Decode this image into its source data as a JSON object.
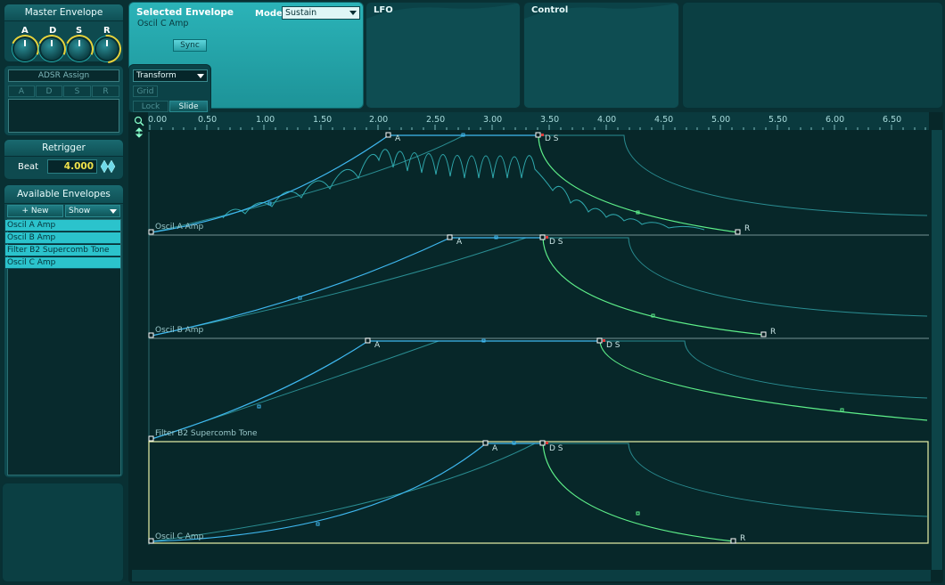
{
  "master_envelope": {
    "title": "Master Envelope",
    "knobs": [
      {
        "label": "A"
      },
      {
        "label": "D"
      },
      {
        "label": "S"
      },
      {
        "label": "R"
      }
    ]
  },
  "adsr_assign": {
    "title": "ADSR Assign",
    "slots": [
      "A",
      "D",
      "S",
      "R"
    ]
  },
  "retrigger": {
    "title": "Retrigger",
    "beat_label": "Beat",
    "beat_value": "4.000"
  },
  "available_envelopes": {
    "title": "Available Envelopes",
    "new_label": "+ New",
    "show_label": "Show",
    "items": [
      "Oscil A Amp",
      "Oscil B Amp",
      "Filter B2 Supercomb Tone",
      "Oscil C Amp"
    ]
  },
  "selected_envelope": {
    "title": "Selected Envelope",
    "name": "Oscil C Amp",
    "mode_label": "Mode",
    "mode_value": "Sustain",
    "sync_label": "Sync"
  },
  "tabs": {
    "lfo": "LFO",
    "control": "Control"
  },
  "transform": {
    "dropdown": "Transform",
    "grid": "Grid",
    "lock": "Lock",
    "slide": "Slide"
  },
  "ruler": {
    "ticks": [
      "0.00",
      "0.50",
      "1.00",
      "1.50",
      "2.00",
      "2.50",
      "3.00",
      "3.50",
      "4.00",
      "4.50",
      "5.00",
      "5.50",
      "6.00",
      "6.50"
    ]
  },
  "lanes": [
    {
      "name": "Oscil A Amp",
      "markers": {
        "attack": "A",
        "ds": "D S",
        "release": "R"
      }
    },
    {
      "name": "Oscil B Amp",
      "markers": {
        "attack": "A",
        "ds": "D S",
        "release": "R"
      }
    },
    {
      "name": "Filter B2 Supercomb Tone",
      "markers": {
        "attack": "A",
        "ds": "D S",
        "release": "R"
      }
    },
    {
      "name": "Oscil C Amp",
      "markers": {
        "attack": "A",
        "ds": "D S",
        "release": "R"
      }
    }
  ],
  "colors": {
    "attack": "#3fb8f0",
    "release": "#5ef08a",
    "ghost": "#2a8d92",
    "selected_border": "#e8f0a8"
  }
}
